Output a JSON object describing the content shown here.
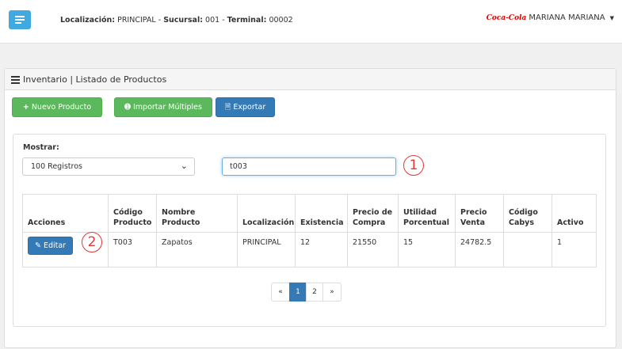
{
  "header": {
    "localizacion_label": "Localización:",
    "localizacion_value": "PRINCIPAL",
    "sucursal_label": "Sucursal:",
    "sucursal_value": "001",
    "terminal_label": "Terminal:",
    "terminal_value": "00002",
    "separator": "-",
    "user_name": "MARIANA MARIANA",
    "logo_text": "Coca-Cola"
  },
  "panel": {
    "title": "Inventario | Listado de Productos"
  },
  "toolbar": {
    "new_label": "Nuevo Producto",
    "import_label": "Importar Múltiples",
    "export_label": "Exportar"
  },
  "filters": {
    "show_label": "Mostrar:",
    "show_value": "100 Registros",
    "search_value": "t003"
  },
  "annotations": {
    "one": "1",
    "two": "2"
  },
  "table": {
    "headers": [
      [
        "Acciones"
      ],
      [
        "Código",
        "Producto"
      ],
      [
        "Nombre",
        "Producto"
      ],
      [
        "Localización"
      ],
      [
        "Existencia"
      ],
      [
        "Precio de",
        "Compra"
      ],
      [
        "Utilidad",
        "Porcentual"
      ],
      [
        "Precio",
        "Venta"
      ],
      [
        "Código",
        "Cabys"
      ],
      [
        "Activo"
      ]
    ],
    "edit_label": "Editar",
    "rows": [
      {
        "codigo": "T003",
        "nombre": "Zapatos",
        "localizacion": "PRINCIPAL",
        "existencia": "12",
        "precio_compra": "21550",
        "utilidad": "15",
        "precio_venta": "24782.5",
        "cabys": "",
        "activo": "1"
      }
    ]
  },
  "pagination": {
    "prev": "«",
    "pages": [
      "1",
      "2"
    ],
    "next": "»",
    "active": "1"
  },
  "colors": {
    "primary": "#337ab7",
    "success": "#5cb85c",
    "menu": "#3fa9e0",
    "callout": "#e53935"
  }
}
